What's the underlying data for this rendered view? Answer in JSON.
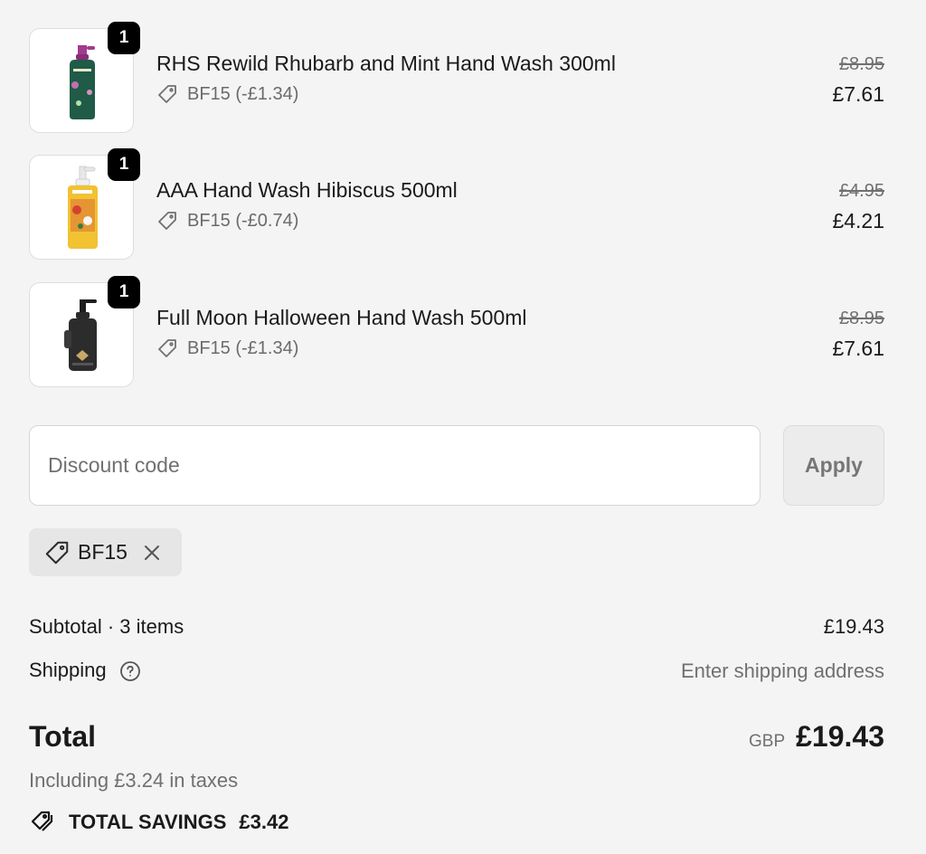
{
  "items": [
    {
      "quantity": "1",
      "name": "RHS Rewild Rhubarb and Mint Hand Wash 300ml",
      "discount": "BF15 (-£1.34)",
      "original_price": "£8.95",
      "price": "£7.61",
      "image_icon": "green-hand-wash-bottle"
    },
    {
      "quantity": "1",
      "name": "AAA Hand Wash Hibiscus 500ml",
      "discount": "BF15 (-£0.74)",
      "original_price": "£4.95",
      "price": "£4.21",
      "image_icon": "yellow-hand-wash-bottle"
    },
    {
      "quantity": "1",
      "name": "Full Moon Halloween Hand Wash 500ml",
      "discount": "BF15 (-£1.34)",
      "original_price": "£8.95",
      "price": "£7.61",
      "image_icon": "black-hand-wash-bottle"
    }
  ],
  "discount": {
    "placeholder": "Discount code",
    "apply_label": "Apply",
    "applied_code": "BF15"
  },
  "summary": {
    "subtotal_label": "Subtotal · 3 items",
    "subtotal_value": "£19.43",
    "shipping_label": "Shipping",
    "shipping_value": "Enter shipping address",
    "total_label": "Total",
    "currency": "GBP",
    "total_value": "£19.43",
    "taxes_note": "Including £3.24 in taxes",
    "savings_label": "TOTAL SAVINGS",
    "savings_value": "£3.42"
  },
  "colors": {
    "background": "#f4f4f4",
    "badge": "#000000",
    "muted_text": "#707070"
  }
}
